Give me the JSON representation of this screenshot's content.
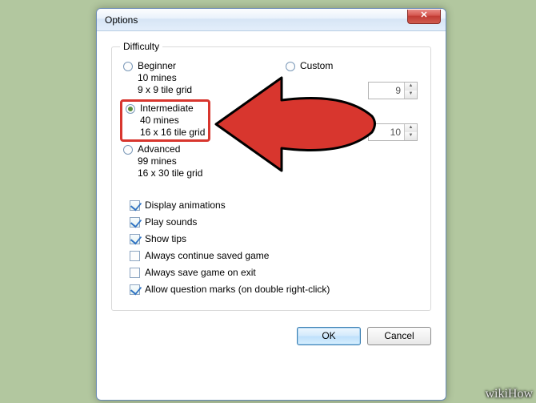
{
  "window": {
    "title": "Options",
    "close_glyph": "✕"
  },
  "group": {
    "legend": "Difficulty"
  },
  "difficulty": {
    "beginner": {
      "name": "Beginner",
      "mines": "10 mines",
      "grid": "9 x 9 tile grid"
    },
    "intermediate": {
      "name": "Intermediate",
      "mines": "40 mines",
      "grid": "16 x 16 tile grid"
    },
    "advanced": {
      "name": "Advanced",
      "mines": "99 mines",
      "grid": "16 x 30 tile grid"
    },
    "custom": {
      "name": "Custom"
    }
  },
  "custom_values": {
    "height": "9",
    "width": "10"
  },
  "checks": {
    "animations": "Display animations",
    "sounds": "Play sounds",
    "tips": "Show tips",
    "cont_saved": "Always continue saved game",
    "save_exit": "Always save game on exit",
    "qmarks": "Allow question marks (on double right-click)"
  },
  "buttons": {
    "ok": "OK",
    "cancel": "Cancel"
  },
  "watermark": "wikiHow"
}
